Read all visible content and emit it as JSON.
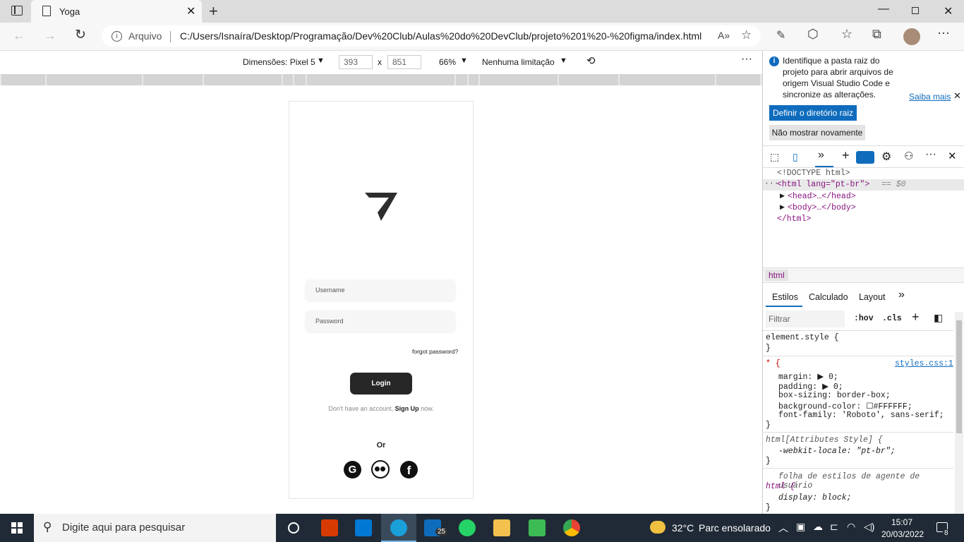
{
  "browser": {
    "tab_title": "Yoga",
    "address_prefix": "Arquivo",
    "url": "C:/Users/Isnaíra/Desktop/Programação/Dev%20Club/Aulas%20do%20DevClub/projeto%201%20-%20figma/index.html"
  },
  "device_toolbar": {
    "device": "Dimensões: Pixel 5",
    "width": "393",
    "times": "x",
    "height": "851",
    "zoom": "66%",
    "throttle": "Nenhuma limitação"
  },
  "page": {
    "username_placeholder": "Username",
    "password_placeholder": "Password",
    "forgot": "forgot password?",
    "login": "Login",
    "signup_prefix": "Don't have an account,",
    "signup_link": "Sign Up",
    "signup_suffix": "now.",
    "or": "Or"
  },
  "devtools": {
    "info_text": "Identifique a pasta raiz do projeto para abrir arquivos de origem Visual Studio Code e sincronize as alterações.",
    "learn_more": "Saiba mais",
    "btn_root": "Definir o diretório raiz",
    "btn_noshow": "Não mostrar novamente",
    "dom": {
      "doctype": "<!DOCTYPE html>",
      "html_open": "<html lang=\"pt-br\">",
      "html_marker": "== $0",
      "head": "<head>…</head>",
      "body": "<body>…</body>",
      "html_close": "</html>"
    },
    "breadcrumb": "html",
    "tabs": [
      "Estilos",
      "Calculado",
      "Layout"
    ],
    "filter_placeholder": "Filtrar",
    "hov": ":hov",
    "cls": ".cls",
    "styles": {
      "element_style": "element.style {",
      "brace_close": "}",
      "star_rule": "* {",
      "source": "styles.css:1",
      "props": [
        "margin: ▶ 0;",
        "padding: ▶ 0;",
        "box-sizing: border-box;",
        "background-color: ☐#FFFFFF;",
        "font-family: 'Roboto', sans-serif;"
      ],
      "attr_rule": "html[Attributes Style] {",
      "attr_prop": "-webkit-locale: \"pt-br\";",
      "ua_label": "folha de estilos de agente de usuário",
      "ua_rule": "html {",
      "ua_prop": "display: block;"
    }
  },
  "taskbar": {
    "search_placeholder": "Digite aqui para pesquisar",
    "mail_badge": "25",
    "weather_temp": "32°C",
    "weather_text": "Parc ensolarado",
    "time": "15:07",
    "date": "20/03/2022",
    "notif_count": "8"
  },
  "colors": {
    "accent": "#0f6cbd",
    "login_button": "#272727",
    "taskbar": "#1f2a36"
  }
}
